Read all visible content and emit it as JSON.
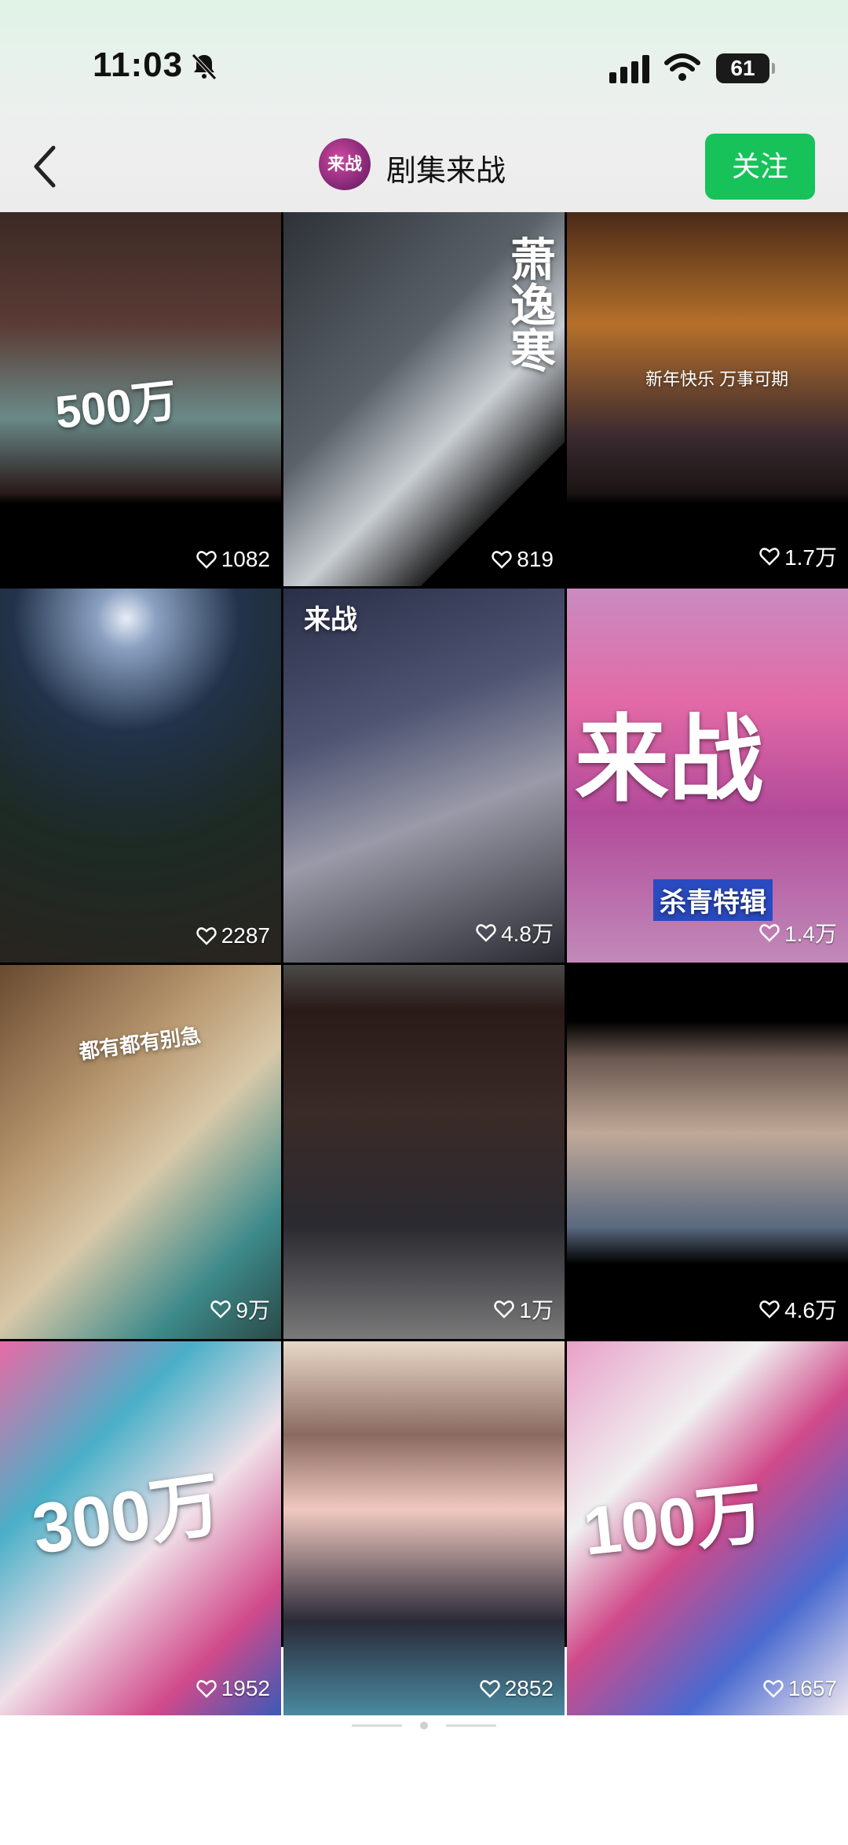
{
  "status": {
    "time": "11:03",
    "battery": "61"
  },
  "header": {
    "account_name": "剧集来战",
    "avatar_text": "来战",
    "follow_label": "关注"
  },
  "grid": [
    {
      "likes": "1082",
      "overlay": "500万"
    },
    {
      "likes": "819",
      "overlay": "萧逸寒"
    },
    {
      "likes": "1.7万",
      "overlay": "新年快乐 万事可期"
    },
    {
      "likes": "2287",
      "overlay": ""
    },
    {
      "likes": "4.8万",
      "overlay": "来战"
    },
    {
      "likes": "1.4万",
      "overlay": "来战",
      "sub": "杀青特辑"
    },
    {
      "likes": "9万",
      "overlay": "都有都有别急"
    },
    {
      "likes": "1万",
      "overlay": ""
    },
    {
      "likes": "4.6万",
      "overlay": ""
    },
    {
      "likes": "1952",
      "overlay": "300万"
    },
    {
      "likes": "2852",
      "overlay": ""
    },
    {
      "likes": "1657",
      "overlay": "100万"
    }
  ],
  "icons": [
    "back-arrow-icon",
    "bell-mute-icon",
    "signal-icon",
    "wifi-icon",
    "battery-icon",
    "heart-icon"
  ],
  "colors": {
    "follow_green": "#17c25a",
    "accent_pink": "#e63a8a"
  }
}
